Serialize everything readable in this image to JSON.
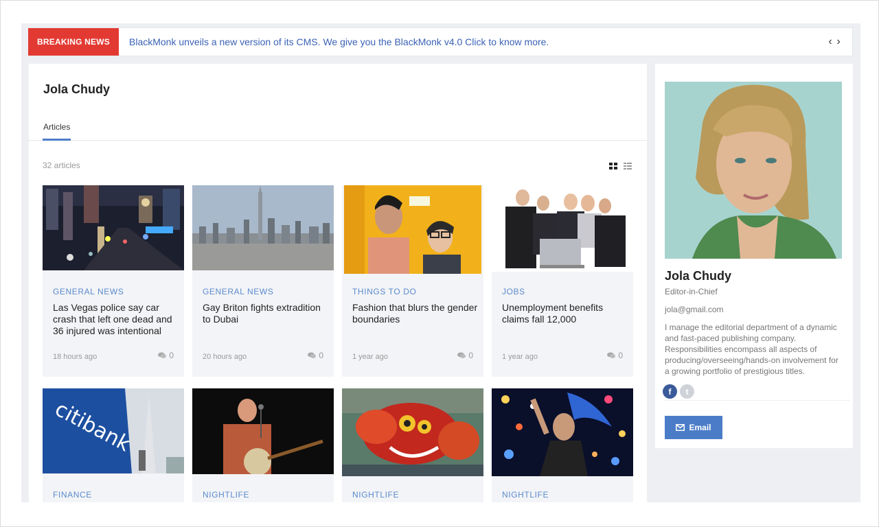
{
  "breaking": {
    "label": "BREAKING NEWS",
    "text": "BlackMonk unveils a new version of its CMS. We give you the BlackMonk v4.0 Click to know more.",
    "prev": "‹",
    "next": "›"
  },
  "main": {
    "title": "Jola Chudy",
    "tab": "Articles",
    "count": "32 articles"
  },
  "articles": [
    {
      "category": "GENERAL NEWS",
      "title": "Las Vegas police say car crash that left one dead and 36 injured was intentional",
      "time": "18 hours ago",
      "comments": "0"
    },
    {
      "category": "GENERAL NEWS",
      "title": "Gay Briton fights extradition to Dubai",
      "time": "20 hours ago",
      "comments": "0"
    },
    {
      "category": "THINGS TO DO",
      "title": "Fashion that blurs the gender boundaries",
      "time": "1 year ago",
      "comments": "0"
    },
    {
      "category": "JOBS",
      "title": "Unemployment benefits claims fall 12,000",
      "time": "1 year ago",
      "comments": "0"
    },
    {
      "category": "FINANCE",
      "title": "",
      "time": "",
      "comments": ""
    },
    {
      "category": "NIGHTLIFE",
      "title": "",
      "time": "",
      "comments": ""
    },
    {
      "category": "NIGHTLIFE",
      "title": "",
      "time": "",
      "comments": ""
    },
    {
      "category": "NIGHTLIFE",
      "title": "",
      "time": "",
      "comments": ""
    }
  ],
  "sidebar": {
    "name": "Jola Chudy",
    "role": "Editor-in-Chief",
    "email": "jola@gmail.com",
    "bio": "I manage the editorial department of a dynamic and fast-paced publishing company. Responsibilities encompass all aspects of producing/overseeing/hands-on involvement for a growing portfolio of prestigious titles.",
    "email_button": "Email",
    "social": {
      "facebook": "f",
      "twitter": "t"
    }
  },
  "icons": {
    "grid": "grid-view-icon",
    "list": "list-view-icon",
    "comment": "comment-icon",
    "mail": "envelope-icon"
  },
  "colors": {
    "breaking": "#e23a33",
    "accent": "#4b7cc7",
    "category": "#5a8acc",
    "link": "#3a62b5"
  }
}
